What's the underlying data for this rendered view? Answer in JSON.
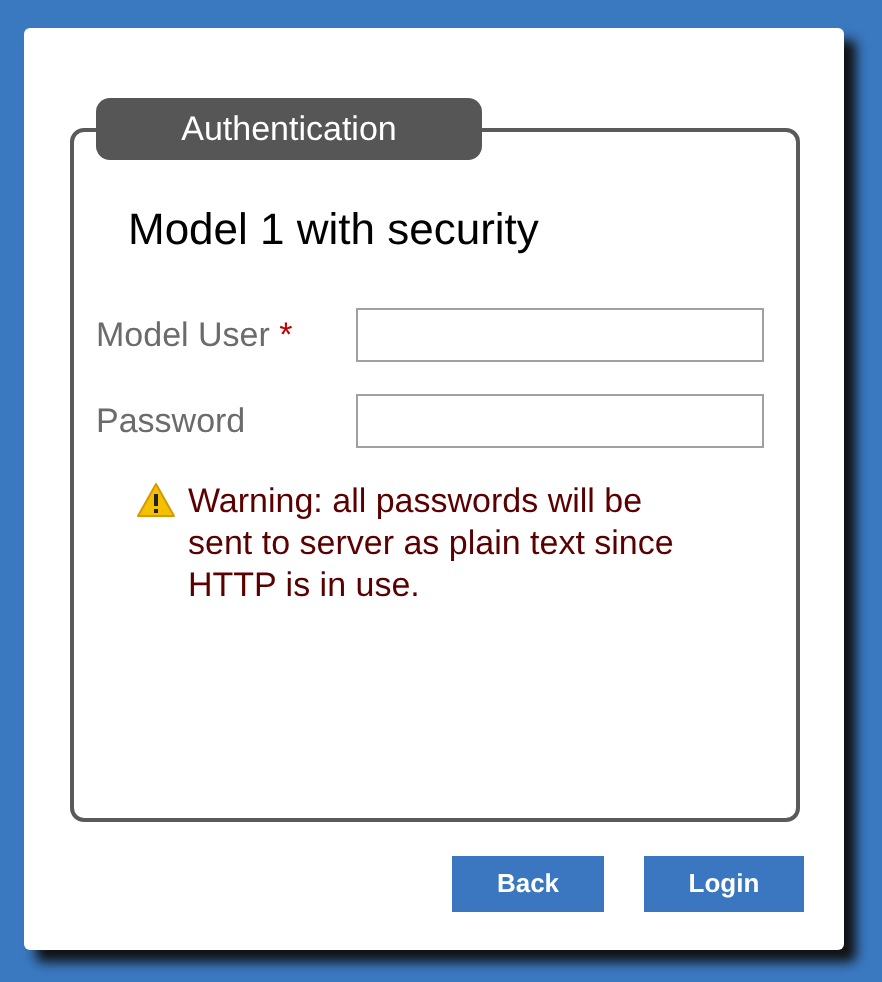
{
  "panel": {
    "legend": "Authentication",
    "title": "Model 1 with security",
    "fields": [
      {
        "label": "Model User",
        "required_mark": "*"
      },
      {
        "label": "Password"
      }
    ],
    "warning": "Warning: all passwords will be sent to server as plain text since HTTP is in use."
  },
  "buttons": [
    "Back",
    "Login"
  ]
}
